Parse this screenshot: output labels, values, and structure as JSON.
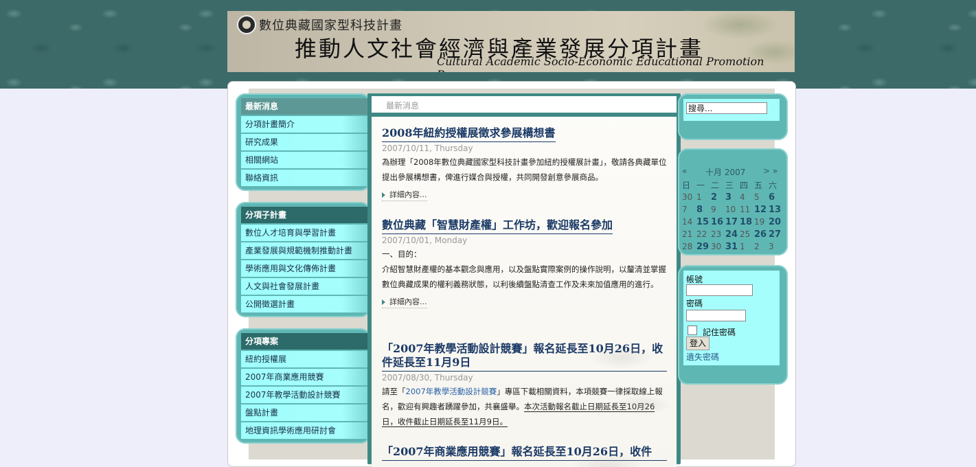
{
  "header": {
    "small_title": "數位典藏國家型科技計畫",
    "main_title": "推動人文社會經濟與產業發展分項計畫",
    "english_title": "Cultural Academic Socio-Economic Educational Promotion Program"
  },
  "left_menus": [
    {
      "heading": "最新消息",
      "items": [
        "分項計畫簡介",
        "研究成果",
        "相關網站",
        "聯絡資訊"
      ]
    },
    {
      "heading": "分項子計畫",
      "items": [
        "數位人才培育與學習計畫",
        "產業發展與規範機制推動計畫",
        "學術應用與文化傳佈計畫",
        "人文與社會發展計畫",
        "公開徵選計畫"
      ]
    },
    {
      "heading": "分項專案",
      "items": [
        "紐約授權展",
        "2007年商業應用競賽",
        "2007年教學活動設計競賽",
        "盤點計畫",
        "地理資訊學術應用研討會"
      ]
    }
  ],
  "breadcrumb": "最新消息",
  "articles": [
    {
      "title": "2008年紐約授權展徵求參展構想書",
      "date": "2007/10/11, Thursday",
      "body": "為辦理「2008年數位典藏國家型科技計畫參加紐約授權展計畫」，敬請各典藏單位提出參展構想書，俾進行媒合與授權，共同開發創意參展商品。",
      "readmore": "詳細內容..."
    },
    {
      "title": "數位典藏「智慧財產權」工作坊，歡迎報名參加",
      "date": "2007/10/01, Monday",
      "body_line1": "一、目的：",
      "body": "介紹智慧財產權的基本觀念與應用，以及盤點實際案例的操作說明，以釐清並掌握數位典藏成果的權利義務狀態，以利後續盤點清查工作及未來加值應用的進行。",
      "readmore": "詳細內容..."
    },
    {
      "title": "「2007年教學活動設計競賽」報名延長至10月26日，收件延長至11月9日",
      "date": "2007/08/30, Thursday",
      "body_pre": "請至「",
      "body_link": "2007年教學活動設計競賽",
      "body_mid": "」專區下載相關資料，本項競賽一律採取線上報名，歡迎有興趣者踴躍參加，共襄盛舉。",
      "body_underline": "本次活動報名截止日期延長至10月26日，收件截止日期延長至11月9日。"
    },
    {
      "title": "「2007年商業應用競賽」報名延長至10月26日，收件"
    }
  ],
  "search": {
    "value": "搜尋..."
  },
  "calendar": {
    "prev_year": "«",
    "prev_month": "",
    "month_label": "十月 2007",
    "next_month": ">",
    "next_year": "»",
    "weekdays": [
      "日",
      "一",
      "二",
      "三",
      "四",
      "五",
      "六"
    ],
    "weeks": [
      [
        "30",
        "1",
        "2",
        "3",
        "4",
        "5",
        "6"
      ],
      [
        "7",
        "8",
        "9",
        "10",
        "11",
        "12",
        "13"
      ],
      [
        "14",
        "15",
        "16",
        "17",
        "18",
        "19",
        "20"
      ],
      [
        "21",
        "22",
        "23",
        "24",
        "25",
        "26",
        "27"
      ],
      [
        "28",
        "29",
        "30",
        "31",
        "1",
        "2",
        "3"
      ]
    ],
    "bold_days": [
      "2",
      "3",
      "6",
      "8",
      "12",
      "13",
      "15",
      "16",
      "17",
      "18",
      "20",
      "24",
      "26",
      "27",
      "29",
      "31"
    ]
  },
  "login": {
    "username_label": "帳號",
    "password_label": "密碼",
    "remember_label": "記住密碼",
    "login_button": "登入",
    "forgot_link": "遺失密碼"
  },
  "colors": {
    "teal_band": "#3c6a69",
    "menu_item": "#a6fefc",
    "menu_head": "#5e9896",
    "menu_head_dark": "#2c6b6a",
    "center_frame": "#3f8985",
    "title": "#1b3a66"
  }
}
